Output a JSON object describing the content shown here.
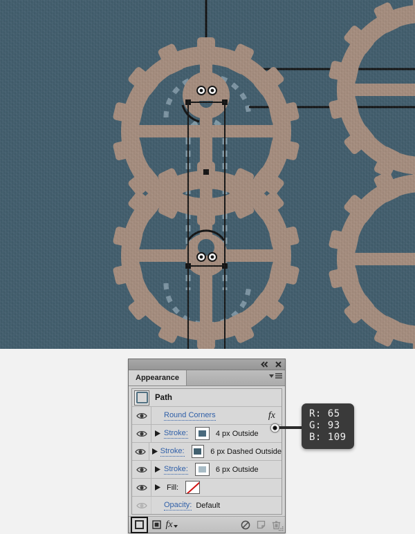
{
  "canvas": {
    "name": "illustrator-artboard",
    "background_color": "#415d6d",
    "gear_color": "#a68d7e",
    "dash_guide_color": "#8ca4b2",
    "guide_line_color": "#111111",
    "selection_color": "#111111"
  },
  "panel": {
    "title": "Appearance",
    "titlebar": {
      "collapse_icon": "double-left-arrow-icon",
      "close_icon": "close-icon",
      "menu_icon": "panel-menu-icon"
    },
    "selected_object": {
      "label": "Path",
      "thumbnail": "path-thumbnail"
    },
    "rows": [
      {
        "type": "effect",
        "label": "Round Corners",
        "has_disclosure": false,
        "has_fx": true,
        "visible": true
      },
      {
        "type": "stroke",
        "label": "Stroke:",
        "swatch_color": "#4a6a7d",
        "description": "4 px  Outside",
        "has_disclosure": true,
        "visible": true
      },
      {
        "type": "stroke",
        "label": "Stroke:",
        "swatch_color": "#41606f",
        "description": "6 px Dashed Outside",
        "has_disclosure": true,
        "visible": true
      },
      {
        "type": "stroke",
        "label": "Stroke:",
        "swatch_color": "#a8bcc6",
        "description": "6 px  Outside",
        "has_disclosure": true,
        "visible": true
      },
      {
        "type": "fill",
        "label": "Fill:",
        "swatch_color": "none",
        "description": "",
        "has_disclosure": true,
        "visible": true
      },
      {
        "type": "opacity",
        "label": "Opacity:",
        "value": "Default",
        "has_disclosure": false,
        "visible": false
      }
    ],
    "footer": {
      "buttons": [
        {
          "name": "add-new-stroke-button",
          "icon": "stroke-square-icon",
          "selected": true
        },
        {
          "name": "add-new-fill-button",
          "icon": "fill-square-icon",
          "selected": false
        },
        {
          "name": "add-new-effect-button",
          "icon": "fx-dropdown-icon",
          "selected": false
        },
        {
          "name": "clear-appearance-button",
          "icon": "no-entry-icon",
          "selected": false
        },
        {
          "name": "duplicate-item-button",
          "icon": "duplicate-icon",
          "selected": false
        },
        {
          "name": "delete-item-button",
          "icon": "trash-icon",
          "selected": false
        }
      ],
      "resize_grip": "resize-grip-icon"
    }
  },
  "tooltip": {
    "name": "rgb-color-callout",
    "lines": [
      "R: 65",
      "G: 93",
      "B: 109"
    ],
    "r": "R: 65",
    "g": "G: 93",
    "b": "B: 109",
    "background": "#3a3a3a"
  }
}
